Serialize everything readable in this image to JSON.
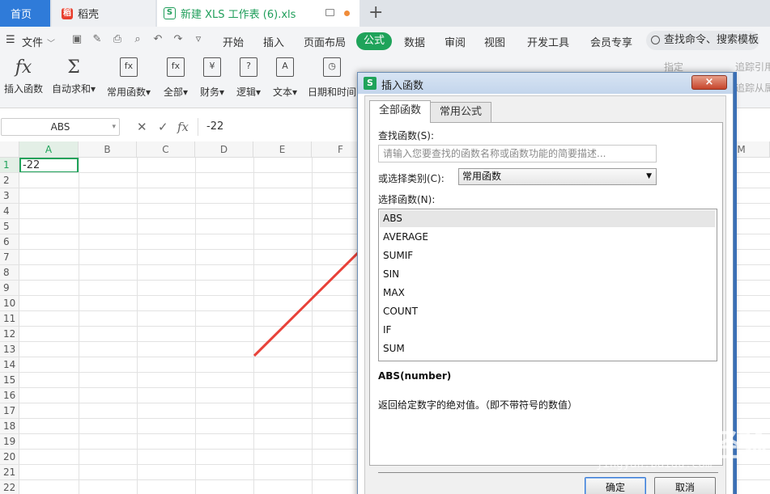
{
  "tabs": {
    "home": "首页",
    "daoke": "稻壳",
    "doc": "新建 XLS 工作表 (6).xls"
  },
  "menu": {
    "file": "文件",
    "items": [
      "开始",
      "插入",
      "页面布局",
      "公式",
      "数据",
      "审阅",
      "视图",
      "开发工具",
      "会员专享"
    ],
    "active": "公式",
    "search": "查找命令、搜索模板"
  },
  "ribbon": {
    "buttons": [
      {
        "label": "插入函数",
        "icon": "fx"
      },
      {
        "label": "自动求和",
        "icon": "Σ"
      },
      {
        "label": "常用函数",
        "icon": "fx"
      },
      {
        "label": "全部",
        "icon": "fx"
      },
      {
        "label": "财务",
        "icon": "¥"
      },
      {
        "label": "逻辑",
        "icon": "?"
      },
      {
        "label": "文本",
        "icon": "A"
      },
      {
        "label": "日期和时间",
        "icon": "◷"
      }
    ],
    "right": [
      "指定",
      "追踪引用单元格",
      "追踪从属单元格"
    ]
  },
  "formula_bar": {
    "name_box": "ABS",
    "value": "-22"
  },
  "grid": {
    "columns": [
      "A",
      "B",
      "C",
      "D",
      "E",
      "F",
      "M"
    ],
    "rows": [
      "1",
      "2",
      "3",
      "4",
      "5",
      "6",
      "7",
      "8",
      "9",
      "10",
      "11",
      "12",
      "13",
      "14",
      "15",
      "16",
      "17",
      "18",
      "19",
      "20",
      "21",
      "22"
    ],
    "a1_value": "-22"
  },
  "dialog": {
    "title": "插入函数",
    "close": "×",
    "tab_all": "全部函数",
    "tab_common": "常用公式",
    "search_label": "查找函数(S):",
    "search_placeholder": "请输入您要查找的函数名称或函数功能的简要描述...",
    "category_label": "或选择类别(C):",
    "category_value": "常用函数",
    "select_label": "选择函数(N):",
    "functions": [
      "ABS",
      "AVERAGE",
      "SUMIF",
      "SIN",
      "MAX",
      "COUNT",
      "IF",
      "SUM"
    ],
    "selected": "ABS",
    "signature": "ABS(number)",
    "description": "返回给定数字的绝对值。（即不带符号的数值）",
    "ok": "确定",
    "cancel": "取消"
  },
  "watermark": {
    "main": "Bai du 经验",
    "sub": "jingyan.baidu.com"
  },
  "colors": {
    "accent": "#1fa35a",
    "tab_home": "#2f7bd9",
    "arrow": "#e8423a"
  }
}
